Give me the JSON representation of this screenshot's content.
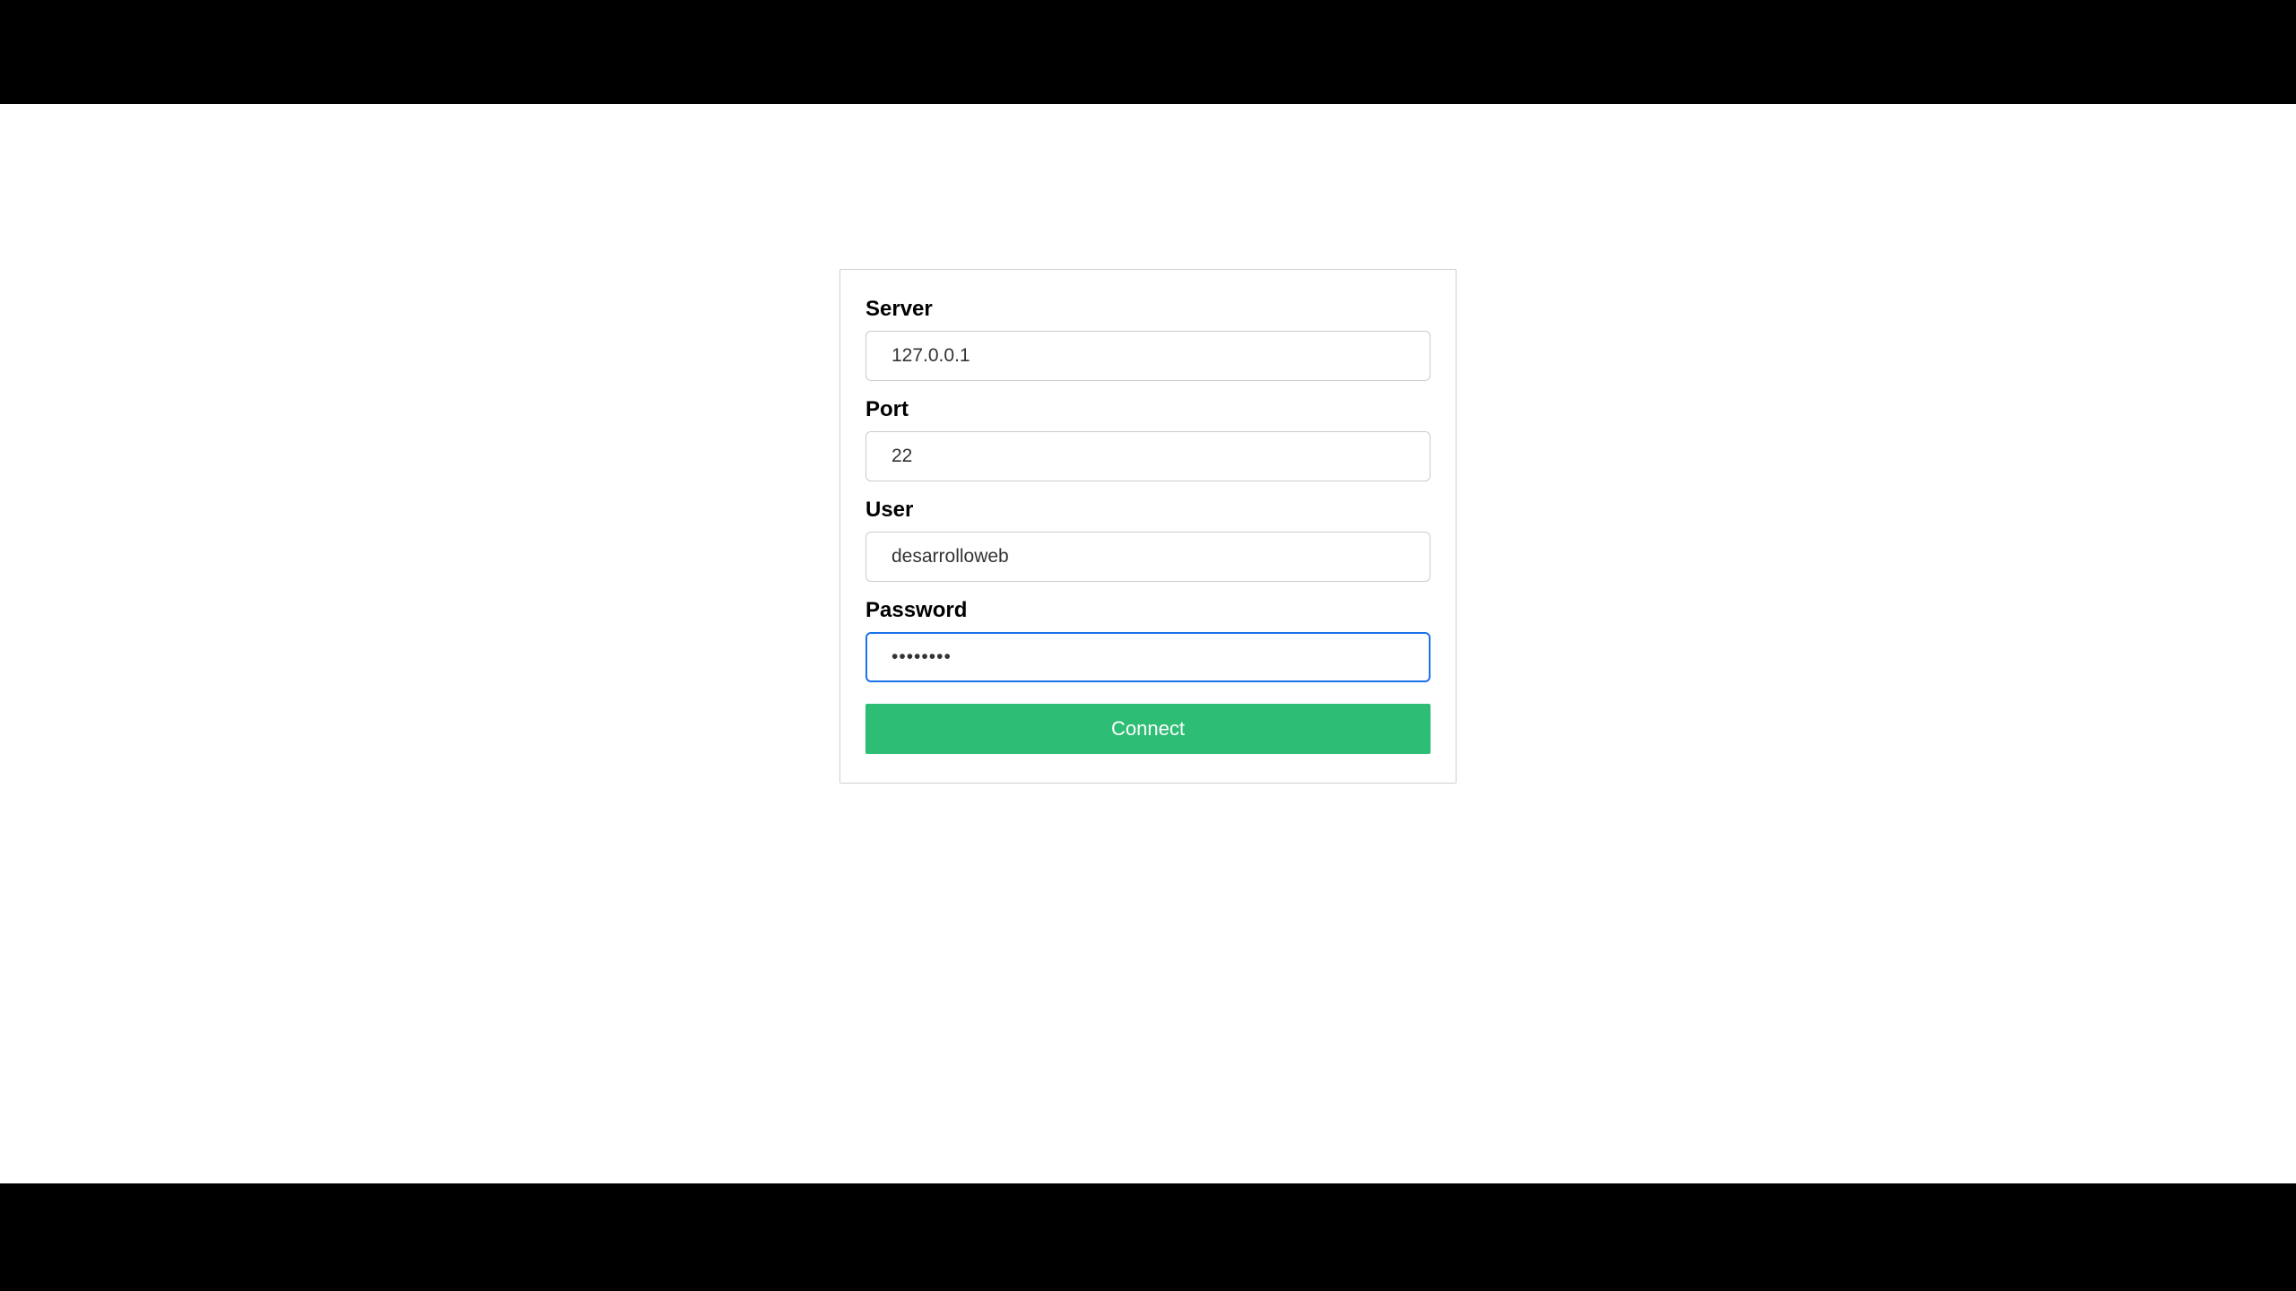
{
  "form": {
    "server": {
      "label": "Server",
      "value": "127.0.0.1"
    },
    "port": {
      "label": "Port",
      "value": "22"
    },
    "user": {
      "label": "User",
      "value": "desarrolloweb"
    },
    "password": {
      "label": "Password",
      "value": "••••••••"
    },
    "connect_label": "Connect"
  }
}
